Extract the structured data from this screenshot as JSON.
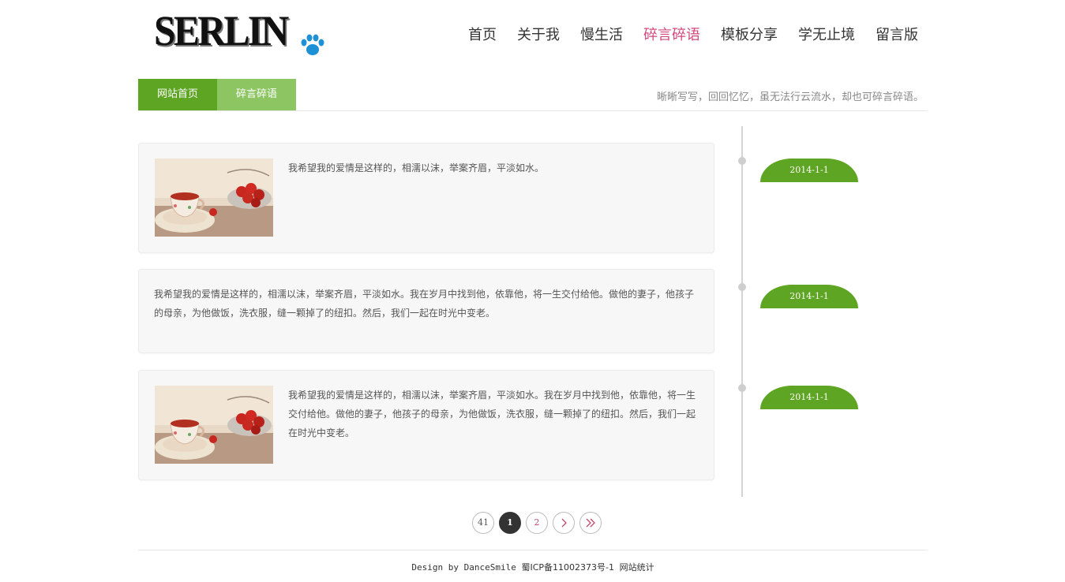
{
  "header": {
    "logo": "SERLIN",
    "nav": [
      {
        "label": "首页",
        "active": false
      },
      {
        "label": "关于我",
        "active": false
      },
      {
        "label": "慢生活",
        "active": false
      },
      {
        "label": "碎言碎语",
        "active": true
      },
      {
        "label": "模板分享",
        "active": false
      },
      {
        "label": "学无止境",
        "active": false
      },
      {
        "label": "留言版",
        "active": false
      }
    ]
  },
  "subbar": {
    "home": "网站首页",
    "current": "碎言碎语",
    "tagline": "晰晰写写，回回忆忆，虽无法行云流水，却也可碎言碎语。"
  },
  "posts": [
    {
      "text": "我希望我的爱情是这样的，相濡以沫，举案齐眉，平淡如水。",
      "date": "2014-1-1",
      "has_image": true
    },
    {
      "text": "我希望我的爱情是这样的，相濡以沫，举案齐眉，平淡如水。我在岁月中找到他，依靠他，将一生交付给他。做他的妻子，他孩子的母亲，为他做饭，洗衣服，缝一颗掉了的纽扣。然后，我们一起在时光中变老。",
      "date": "2014-1-1",
      "has_image": false
    },
    {
      "text": "我希望我的爱情是这样的，相濡以沫，举案齐眉，平淡如水。我在岁月中找到他，依靠他，将一生交付给他。做他的妻子，他孩子的母亲，为他做饭，洗衣服，缝一颗掉了的纽扣。然后，我们一起在时光中变老。",
      "date": "2014-1-1",
      "has_image": true
    }
  ],
  "pagination": {
    "first": "41",
    "current": "1",
    "next_page": "2",
    "next_icon": "chevron-right-icon",
    "last_icon": "double-chevron-right-icon"
  },
  "footer": {
    "design": "Design by DanceSmile",
    "icp": "蜀ICP备11002373号-1",
    "stats": "网站统计"
  },
  "colors": {
    "green": "#5ea524",
    "light_green": "#8cc562",
    "nav_active": "#d04a7c"
  }
}
